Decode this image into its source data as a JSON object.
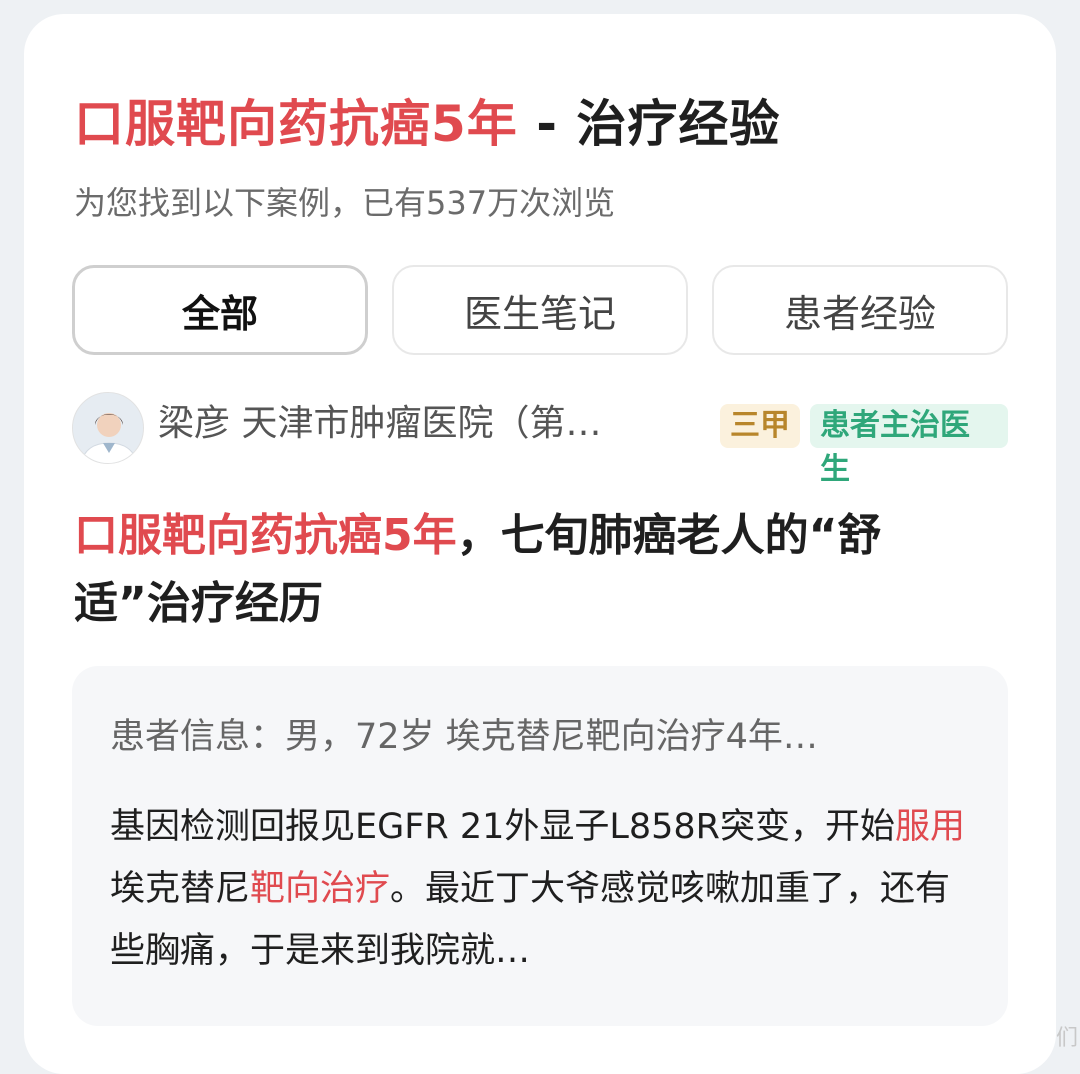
{
  "header": {
    "title_highlight": "口服靶向药抗癌5年",
    "title_separator": " - ",
    "title_rest": "治疗经验",
    "subtitle": "为您找到以下案例，已有537万次浏览"
  },
  "tabs": [
    {
      "label": "全部",
      "active": true
    },
    {
      "label": "医生笔记",
      "active": false
    },
    {
      "label": "患者经验",
      "active": false
    }
  ],
  "author": {
    "name_hospital": "梁彦 天津市肿瘤医院（第…",
    "badge_level": "三甲",
    "badge_role": "患者主治医生"
  },
  "article": {
    "title_highlight": "口服靶向药抗癌5年",
    "title_rest": "，七旬肺癌老人的“舒适”治疗经历",
    "patient_info": "患者信息：男，72岁 埃克替尼靶向治疗4年…",
    "excerpt_1": "基因检测回报见EGFR 21外显子L858R突变，开始",
    "excerpt_hl_1": "服用",
    "excerpt_2": "埃克替尼",
    "excerpt_hl_2": "靶向治疗",
    "excerpt_3": "。最近丁大爷感觉咳嗽加重了，还有些胸痛，于是来到我院就…"
  },
  "watermark": "们",
  "colors": {
    "highlight": "#e04a4f",
    "badge_level_bg": "#fbf1dd",
    "badge_level_text": "#b8862b",
    "badge_role_bg": "#e4f6ee",
    "badge_role_text": "#2fa77a"
  },
  "icons": {
    "avatar": "doctor-avatar"
  }
}
